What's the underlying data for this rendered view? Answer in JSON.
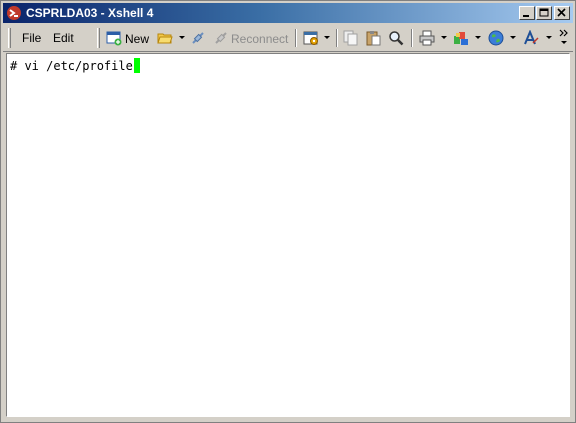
{
  "window": {
    "title": "CSPRLDA03 - Xshell 4",
    "controls": {
      "minimize": "minimize",
      "restore": "restore",
      "close": "close"
    }
  },
  "menu": [
    {
      "label": "File"
    },
    {
      "label": "Edit"
    }
  ],
  "toolbar": {
    "new_label": "New",
    "reconnect_label": "Reconnect",
    "icons": [
      "new-session-icon",
      "open-folder-icon",
      "connect-icon",
      "reconnect-icon",
      "properties-icon",
      "copy-icon",
      "paste-icon",
      "find-icon",
      "print-icon",
      "transfer-icon",
      "globe-icon",
      "font-icon",
      "more-icon"
    ]
  },
  "terminal": {
    "line": "# vi /etc/profile",
    "cursor_color": "#00ff00"
  }
}
